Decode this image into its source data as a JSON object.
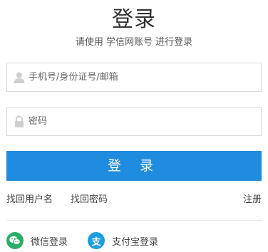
{
  "header": {
    "title": "登录",
    "subtitle": "请使用 学信网账号 进行登录"
  },
  "form": {
    "username_placeholder": "手机号/身份证号/邮箱",
    "password_placeholder": "密码",
    "submit_label": "登 录"
  },
  "links": {
    "find_username": "找回用户名",
    "find_password": "找回密码",
    "register": "注册"
  },
  "third_party": {
    "wechat_label": "微信登录",
    "alipay_label": "支付宝登录",
    "alipay_glyph": "支"
  },
  "colors": {
    "accent": "#1f8ce0",
    "wechat": "#2aae67",
    "alipay": "#1a9ee3"
  },
  "icons": {
    "username": "user-icon",
    "password": "lock-icon",
    "wechat": "wechat-icon",
    "alipay": "alipay-icon"
  }
}
